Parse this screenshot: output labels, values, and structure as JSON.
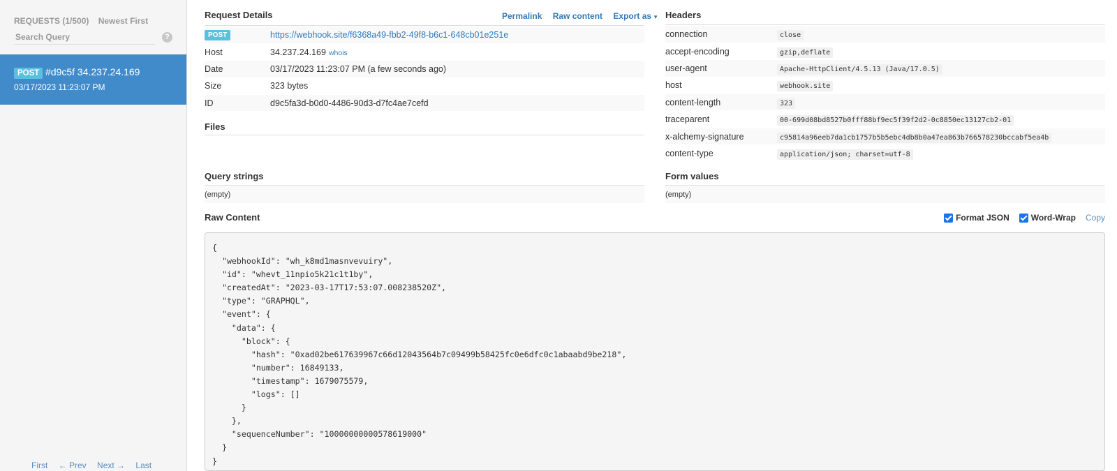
{
  "sidebar": {
    "requests_label": "REQUESTS (1/500)",
    "sort_label": "Newest First",
    "search_placeholder": "Search Query",
    "help_glyph": "?",
    "selected_request": {
      "method": "POST",
      "title": "#d9c5f 34.237.24.169",
      "time": "03/17/2023 11:23:07 PM"
    },
    "pager": {
      "first": "First",
      "prev": "← Prev",
      "next": "Next →",
      "last": "Last"
    }
  },
  "details": {
    "title": "Request Details",
    "actions": {
      "permalink": "Permalink",
      "raw_content": "Raw content",
      "export_as": "Export as",
      "caret": "▼"
    },
    "method": "POST",
    "url": "https://webhook.site/f6368a49-fbb2-49f8-b6c1-648cb01e251e",
    "rows": [
      {
        "key": "Host",
        "value": "34.237.24.169",
        "extra": "whois"
      },
      {
        "key": "Date",
        "value": "03/17/2023 11:23:07 PM (a few seconds ago)"
      },
      {
        "key": "Size",
        "value": "323 bytes"
      },
      {
        "key": "ID",
        "value": "d9c5fa3d-b0d0-4486-90d3-d7fc4ae7cefd"
      }
    ]
  },
  "files": {
    "title": "Files"
  },
  "query_strings": {
    "title": "Query strings",
    "empty": "(empty)"
  },
  "headers": {
    "title": "Headers",
    "rows": [
      {
        "key": "connection",
        "value": "close"
      },
      {
        "key": "accept-encoding",
        "value": "gzip,deflate"
      },
      {
        "key": "user-agent",
        "value": "Apache-HttpClient/4.5.13 (Java/17.0.5)"
      },
      {
        "key": "host",
        "value": "webhook.site"
      },
      {
        "key": "content-length",
        "value": "323"
      },
      {
        "key": "traceparent",
        "value": "00-699d08bd8527b0fff88bf9ec5f39f2d2-0c8850ec13127cb2-01"
      },
      {
        "key": "x-alchemy-signature",
        "value": "c95814a96eeb7da1cb1757b5b5ebc4db8b0a47ea863b766578230bccabf5ea4b"
      },
      {
        "key": "content-type",
        "value": "application/json; charset=utf-8"
      }
    ]
  },
  "form_values": {
    "title": "Form values",
    "empty": "(empty)"
  },
  "raw": {
    "title": "Raw Content",
    "format_json_label": "Format JSON",
    "format_json_checked": true,
    "word_wrap_label": "Word-Wrap",
    "word_wrap_checked": true,
    "copy_label": "Copy",
    "body": "{\n  \"webhookId\": \"wh_k8md1masnvevuiry\",\n  \"id\": \"whevt_11npio5k21c1t1by\",\n  \"createdAt\": \"2023-03-17T17:53:07.008238520Z\",\n  \"type\": \"GRAPHQL\",\n  \"event\": {\n    \"data\": {\n      \"block\": {\n        \"hash\": \"0xad02be617639967c66d12043564b7c09499b58425fc0e6dfc0c1abaabd9be218\",\n        \"number\": 16849133,\n        \"timestamp\": 1679075579,\n        \"logs\": []\n      }\n    },\n    \"sequenceNumber\": \"10000000000578619000\"\n  }\n}"
  }
}
